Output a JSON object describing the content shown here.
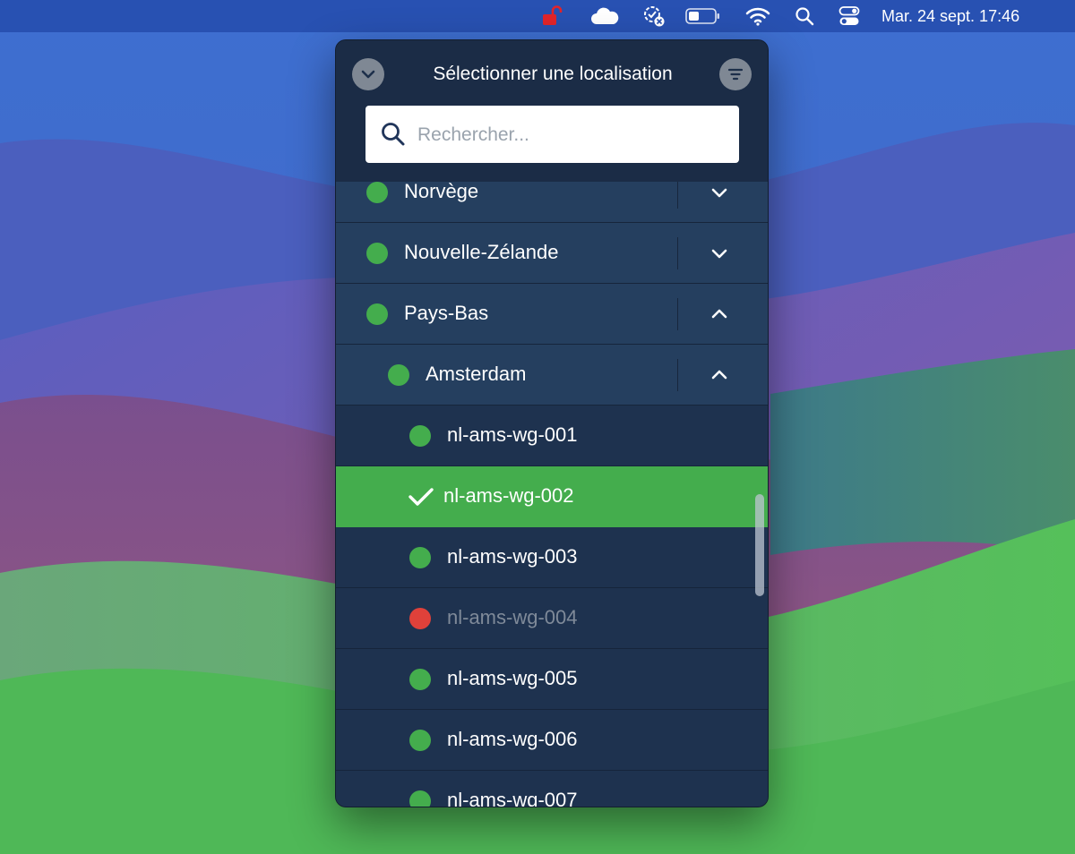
{
  "menubar": {
    "icons": [
      "vpn-unlocked-icon",
      "cloud-icon",
      "sync-status-icon",
      "battery-icon",
      "wifi-icon",
      "spotlight-search-icon",
      "control-center-icon"
    ],
    "clock": "Mar. 24 sept.  17:46",
    "vpn_icon_color": "#e2242a",
    "battery_level": 0.4
  },
  "panel": {
    "title": "Sélectionner une localisation",
    "collapse_icon": "chevron-down-icon",
    "filter_icon": "filter-icon",
    "search": {
      "placeholder": "Rechercher...",
      "value": ""
    }
  },
  "locations": {
    "countries": [
      {
        "label": "Norvège",
        "status": "online",
        "expanded": false
      },
      {
        "label": "Nouvelle-Zélande",
        "status": "online",
        "expanded": false
      },
      {
        "label": "Pays-Bas",
        "status": "online",
        "expanded": true
      }
    ],
    "city": {
      "label": "Amsterdam",
      "status": "online",
      "expanded": true
    },
    "servers": [
      {
        "label": "nl-ams-wg-001",
        "status": "online",
        "selected": false
      },
      {
        "label": "nl-ams-wg-002",
        "status": "online",
        "selected": true
      },
      {
        "label": "nl-ams-wg-003",
        "status": "online",
        "selected": false
      },
      {
        "label": "nl-ams-wg-004",
        "status": "offline",
        "selected": false
      },
      {
        "label": "nl-ams-wg-005",
        "status": "online",
        "selected": false
      },
      {
        "label": "nl-ams-wg-006",
        "status": "online",
        "selected": false
      },
      {
        "label": "nl-ams-wg-007",
        "status": "online",
        "selected": false
      }
    ]
  },
  "colors": {
    "online": "#44ad4d",
    "offline": "#e0413a",
    "selected_row": "#44ad4d",
    "panel_bg": "#1d2f4a"
  }
}
